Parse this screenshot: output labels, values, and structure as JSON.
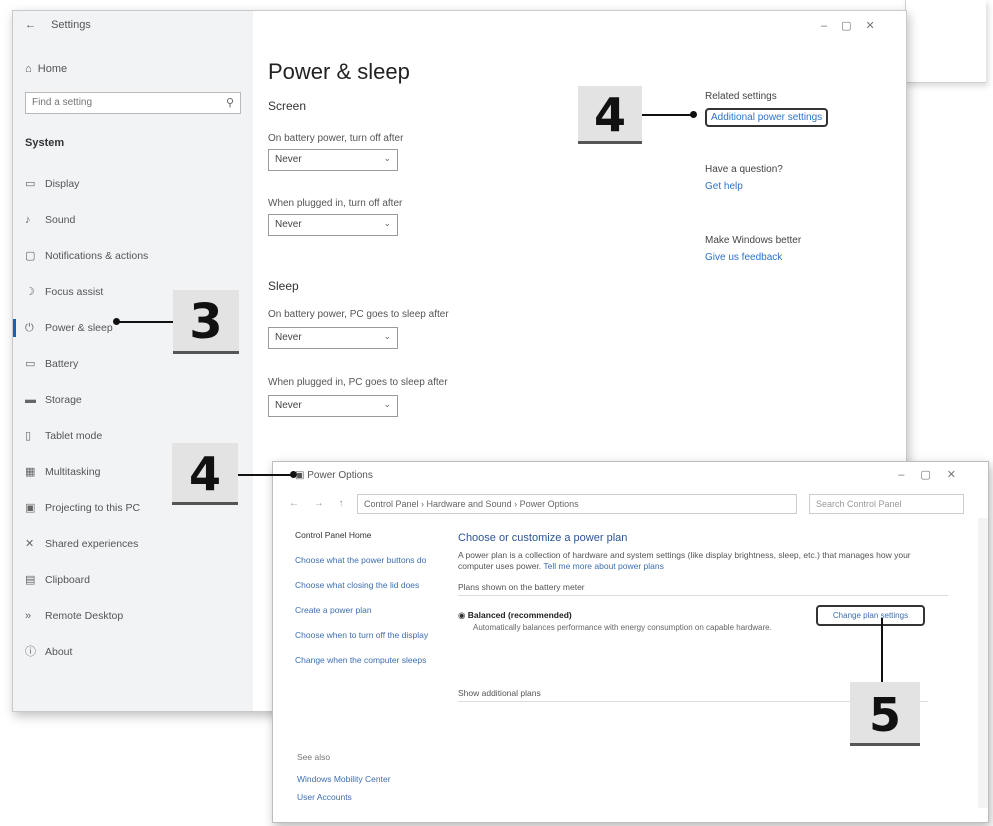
{
  "settings": {
    "title": "Settings",
    "back_icon": "arrow-left-icon",
    "window_controls": [
      "–",
      "▢",
      "✕"
    ],
    "home_label": "Home",
    "search_placeholder": "Find a setting",
    "section_label": "System",
    "nav": [
      {
        "icon": "display-icon",
        "glyph": "▭",
        "label": "Display"
      },
      {
        "icon": "sound-icon",
        "glyph": "♪",
        "label": "Sound"
      },
      {
        "icon": "notifications-icon",
        "glyph": "▢",
        "label": "Notifications & actions"
      },
      {
        "icon": "focus-assist-icon",
        "glyph": "☽",
        "label": "Focus assist"
      },
      {
        "icon": "power-icon",
        "glyph": "⏻",
        "label": "Power & sleep"
      },
      {
        "icon": "battery-icon",
        "glyph": "▭",
        "label": "Battery"
      },
      {
        "icon": "storage-icon",
        "glyph": "▬",
        "label": "Storage"
      },
      {
        "icon": "tablet-icon",
        "glyph": "▯",
        "label": "Tablet mode"
      },
      {
        "icon": "multitasking-icon",
        "glyph": "▦",
        "label": "Multitasking"
      },
      {
        "icon": "projecting-icon",
        "glyph": "▣",
        "label": "Projecting to this PC"
      },
      {
        "icon": "shared-experiences-icon",
        "glyph": "✕",
        "label": "Shared experiences"
      },
      {
        "icon": "clipboard-icon",
        "glyph": "▤",
        "label": "Clipboard"
      },
      {
        "icon": "remote-desktop-icon",
        "glyph": "»",
        "label": "Remote Desktop"
      },
      {
        "icon": "about-icon",
        "glyph": "ⓘ",
        "label": "About"
      }
    ],
    "page_title": "Power & sleep",
    "screen_heading": "Screen",
    "screen_battery_label": "On battery power, turn off after",
    "screen_battery_value": "Never",
    "screen_plugged_label": "When plugged in, turn off after",
    "screen_plugged_value": "Never",
    "sleep_heading": "Sleep",
    "sleep_battery_label": "On battery power, PC goes to sleep after",
    "sleep_battery_value": "Never",
    "sleep_plugged_label": "When plugged in, PC goes to sleep after",
    "sleep_plugged_value": "Never",
    "related_title": "Related settings",
    "related_link": "Additional power settings",
    "question_title": "Have a question?",
    "question_link": "Get help",
    "feedback_title": "Make Windows better",
    "feedback_link": "Give us feedback"
  },
  "callouts": {
    "step3": "3",
    "step4_top": "4",
    "step4_bottom": "4",
    "step5": "5"
  },
  "power_options": {
    "title": "Power Options",
    "window_controls": [
      "–",
      "▢",
      "✕"
    ],
    "nav_buttons": "← → ↑",
    "breadcrumb": "Control Panel  ›  Hardware and Sound  ›  Power Options",
    "search_placeholder": "Search Control Panel",
    "left_links": [
      "Control Panel Home",
      "Choose what the power buttons do",
      "Choose what closing the lid does",
      "Create a power plan",
      "Choose when to turn off the display",
      "Change when the computer sleeps"
    ],
    "see_also": "See also",
    "see_also_links": [
      "Windows Mobility Center",
      "User Accounts"
    ],
    "heading": "Choose or customize a power plan",
    "description": "A power plan is a collection of hardware and system settings (like display brightness, sleep, etc.) that manages how your computer uses power.",
    "description_link": "Tell me more about power plans",
    "plans_label": "Plans shown on the battery meter",
    "plan_name": "Balanced (recommended)",
    "plan_desc": "Automatically balances performance with energy consumption on capable hardware.",
    "change_plan_settings": "Change plan settings",
    "additional_plans": "Show additional plans"
  }
}
